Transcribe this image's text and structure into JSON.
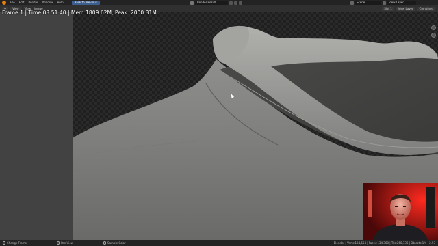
{
  "topbar": {
    "menus": [
      "File",
      "Edit",
      "Render",
      "Window",
      "Help"
    ],
    "back_button": "Back to Previous",
    "image_name": "Render Result",
    "scene": "Scene",
    "view_layer": "View Layer"
  },
  "editor_header": {
    "view": "View",
    "view2": "View",
    "image": "Image",
    "slot": "Slot 1",
    "layer": "View Layer",
    "pass": "Combined"
  },
  "overlay_stats": "Frame:1 | Time:03:51.40 | Mem:1809.62M, Peak: 2000.31M",
  "statusbar": {
    "items": [
      {
        "icon": "mouse-left-icon",
        "label": "Change Frame"
      },
      {
        "icon": "mouse-middle-icon",
        "label": "Pan View"
      },
      {
        "icon": "mouse-right-icon",
        "label": "Sample Color"
      }
    ],
    "info": "Blender | Verts:134,654 | Faces:134,368 | Tris:268,736 | Objects:1/4 | 2.93"
  },
  "colors": {
    "accent_button": "#3d5f8f",
    "blender_logo": "#e87d0d",
    "webcam_light": "#ff2a1f"
  }
}
